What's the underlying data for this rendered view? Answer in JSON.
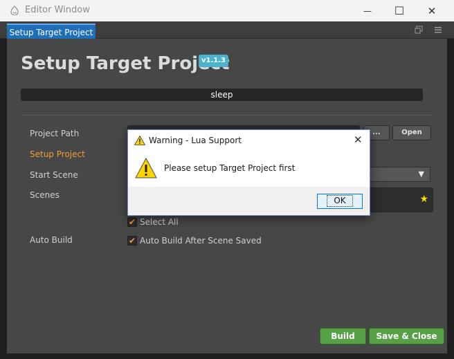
{
  "window": {
    "title": "Editor Window",
    "minimize_glyph": "—",
    "maximize_glyph": "☐",
    "close_glyph": "✕"
  },
  "tab": {
    "label": "Setup Target Project"
  },
  "main": {
    "heading": "Setup Target Project",
    "version": "v1.1.3",
    "status": "sleep",
    "labels": {
      "project_path": "Project Path",
      "setup_project": "Setup Project",
      "start_scene": "Start Scene",
      "scenes": "Scenes",
      "auto_build": "Auto Build"
    },
    "browse_label": "...",
    "open_label": "Open",
    "select_all_label": "Select All",
    "auto_build_label": "Auto Build After Scene Saved",
    "build_label": "Build",
    "save_close_label": "Save & Close"
  },
  "dialog": {
    "title": "Warning - Lua Support",
    "message": "Please setup Target Project first",
    "ok_label": "OK"
  },
  "colors": {
    "accent_blue": "#1f6fb8",
    "active_label": "#f0a030",
    "build_green": "#58a046",
    "version_badge": "#4cb3cf"
  }
}
